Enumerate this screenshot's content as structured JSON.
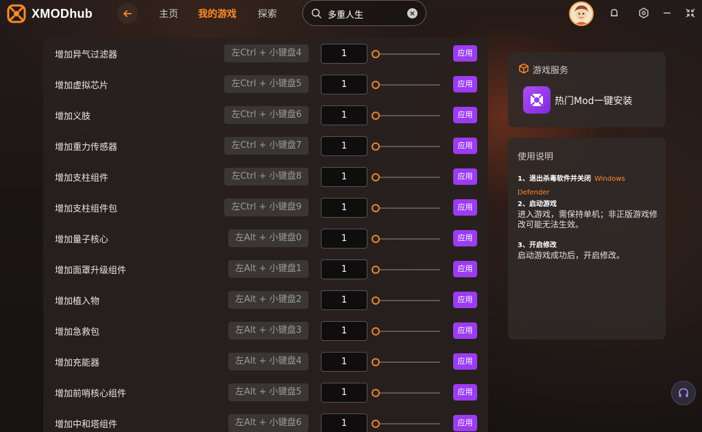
{
  "app": {
    "name": "XMODhub"
  },
  "nav": {
    "home": "主页",
    "my_games": "我的游戏",
    "explore": "探索"
  },
  "search": {
    "value": "多重人生"
  },
  "colors": {
    "accent": "#ff8a2b",
    "apply": "#9b3cf0"
  },
  "rows": [
    {
      "label": "增加异气过滤器",
      "hotkey": "左Ctrl + 小键盘4",
      "value": "1",
      "apply": "应用"
    },
    {
      "label": "增加虚拟芯片",
      "hotkey": "左Ctrl + 小键盘5",
      "value": "1",
      "apply": "应用"
    },
    {
      "label": "增加义肢",
      "hotkey": "左Ctrl + 小键盘6",
      "value": "1",
      "apply": "应用"
    },
    {
      "label": "增加重力传感器",
      "hotkey": "左Ctrl + 小键盘7",
      "value": "1",
      "apply": "应用"
    },
    {
      "label": "增加支柱组件",
      "hotkey": "左Ctrl + 小键盘8",
      "value": "1",
      "apply": "应用"
    },
    {
      "label": "增加支柱组件包",
      "hotkey": "左Ctrl + 小键盘9",
      "value": "1",
      "apply": "应用"
    },
    {
      "label": "增加量子核心",
      "hotkey": "左Alt + 小键盘0",
      "value": "1",
      "apply": "应用"
    },
    {
      "label": "增加面罩升级组件",
      "hotkey": "左Alt + 小键盘1",
      "value": "1",
      "apply": "应用"
    },
    {
      "label": "增加植入物",
      "hotkey": "左Alt + 小键盘2",
      "value": "1",
      "apply": "应用"
    },
    {
      "label": "增加急救包",
      "hotkey": "左Alt + 小键盘3",
      "value": "1",
      "apply": "应用"
    },
    {
      "label": "增加充能器",
      "hotkey": "左Alt + 小键盘4",
      "value": "1",
      "apply": "应用"
    },
    {
      "label": "增加前哨核心组件",
      "hotkey": "左Alt + 小键盘5",
      "value": "1",
      "apply": "应用"
    },
    {
      "label": "增加中和塔组件",
      "hotkey": "左Alt + 小键盘6",
      "value": "1",
      "apply": "应用"
    }
  ],
  "service": {
    "title": "游戏服务",
    "mod_install": "热门Mod一键安装"
  },
  "help": {
    "title": "使用说明",
    "step1_head": "1、退出杀毒软件并关闭",
    "step1_link": "Windows Defender",
    "step2_head": "2、启动游戏",
    "step2_body": "进入游戏，需保持单机；非正版游戏修改可能无法生效。",
    "step3_head": "3、开启修改",
    "step3_body": "启动游戏成功后，开启修改。"
  }
}
